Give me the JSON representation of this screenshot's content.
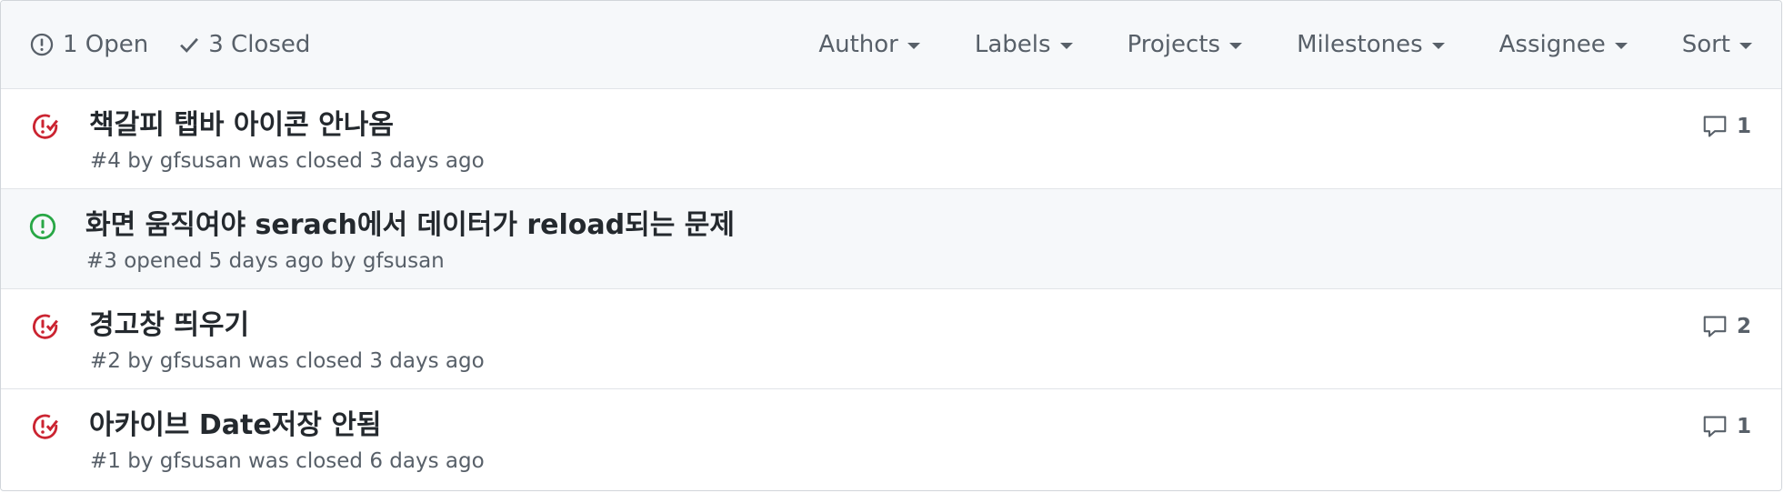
{
  "header": {
    "open_label": "1 Open",
    "closed_label": "3 Closed",
    "filters": [
      "Author",
      "Labels",
      "Projects",
      "Milestones",
      "Assignee",
      "Sort"
    ]
  },
  "colors": {
    "closed": "#cb2431",
    "open": "#28a745",
    "muted": "#586069",
    "text": "#24292e"
  },
  "issues": [
    {
      "title": "책갈피 탭바 아이콘 안나옴",
      "meta_number": "#4",
      "meta_by": "by",
      "meta_author": "gfsusan",
      "meta_rest": "was closed 3 days ago",
      "state": "closed",
      "state_icon": "issue-closed-icon",
      "comments": "1"
    },
    {
      "title": "화면 움직여야 serach에서 데이터가 reload되는 문제",
      "meta_number": "#3",
      "meta_by": "opened 5 days ago by",
      "meta_author": "gfsusan",
      "meta_rest": "",
      "state": "open",
      "state_icon": "issue-open-icon",
      "comments": ""
    },
    {
      "title": "경고창 띄우기",
      "meta_number": "#2",
      "meta_by": "by",
      "meta_author": "gfsusan",
      "meta_rest": "was closed 3 days ago",
      "state": "closed",
      "state_icon": "issue-closed-icon",
      "comments": "2"
    },
    {
      "title": "아카이브 Date저장 안됨",
      "meta_number": "#1",
      "meta_by": "by",
      "meta_author": "gfsusan",
      "meta_rest": "was closed 6 days ago",
      "state": "closed",
      "state_icon": "issue-closed-icon",
      "comments": "1"
    }
  ]
}
